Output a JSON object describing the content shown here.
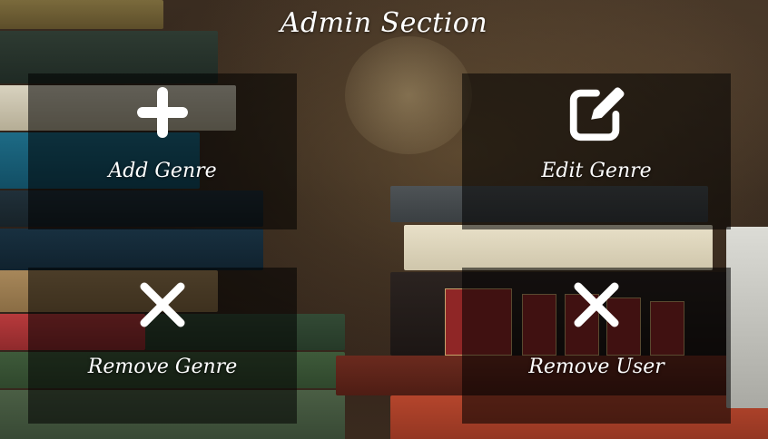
{
  "page": {
    "title": "Admin Section"
  },
  "cards": [
    {
      "label": "Add Genre",
      "icon": "plus-icon"
    },
    {
      "label": "Edit Genre",
      "icon": "edit-icon"
    },
    {
      "label": "Remove Genre",
      "icon": "close-icon"
    },
    {
      "label": "Remove User",
      "icon": "close-icon"
    }
  ],
  "colors": {
    "text": "#ffffff",
    "card_overlay": "rgba(0,0,0,0.55)"
  }
}
